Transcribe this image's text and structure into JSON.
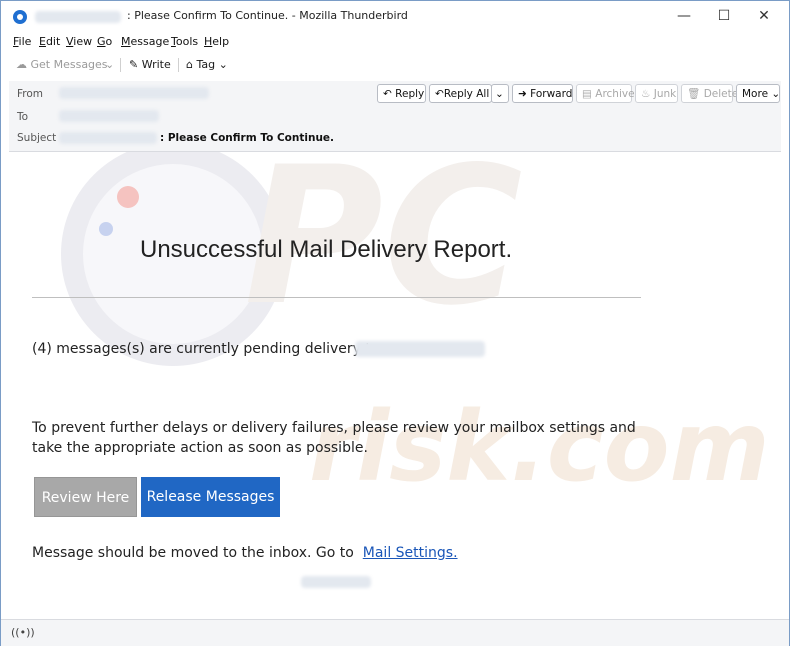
{
  "window": {
    "title": ": Please Confirm To Continue. - Mozilla Thunderbird",
    "controls": {
      "minimize": "—",
      "maximize": "☐",
      "close": "✕"
    }
  },
  "menubar": [
    {
      "accel": "F",
      "rest": "ile"
    },
    {
      "accel": "E",
      "rest": "dit"
    },
    {
      "accel": "V",
      "rest": "iew"
    },
    {
      "accel": "G",
      "rest": "o"
    },
    {
      "accel": "M",
      "rest": "essage"
    },
    {
      "accel": "T",
      "rest": "ools"
    },
    {
      "accel": "H",
      "rest": "elp"
    }
  ],
  "toolbar": {
    "get_messages": "Get Messages",
    "write": "Write",
    "tag": "Tag"
  },
  "header": {
    "from_label": "From",
    "to_label": "To",
    "subject_label": "Subject",
    "subject": ": Please Confirm To Continue.",
    "actions": {
      "reply": "Reply",
      "reply_all": "Reply All",
      "forward": "Forward",
      "archive": "Archive",
      "junk": "Junk",
      "delete": "Delete",
      "more": "More"
    }
  },
  "message": {
    "title": "Unsuccessful Mail Delivery Report.",
    "pending": "(4) messages(s) are currently pending delivery to",
    "instructions": "To prevent further delays or delivery failures, please review your mailbox settings and take the appropriate action as soon as possible.",
    "review_button": "Review Here",
    "release_button": "Release Messages",
    "moved_text": "Message should be moved to the inbox. Go to",
    "settings_link": "Mail Settings."
  },
  "watermark": {
    "brand_top": "PC",
    "brand_bottom": "risk.com"
  },
  "colors": {
    "release_button": "#2067c4",
    "review_button": "#a8a8a8",
    "link": "#1a56b8"
  },
  "icons": {
    "app": "thunderbird-icon",
    "get_messages": "cloud-download-icon",
    "write": "pencil-icon",
    "tag": "tag-icon",
    "reply": "reply-icon",
    "reply_all": "reply-all-icon",
    "forward": "forward-icon",
    "archive": "archive-icon",
    "junk": "flame-icon",
    "delete": "trash-icon",
    "status": "wireless-status-icon"
  }
}
